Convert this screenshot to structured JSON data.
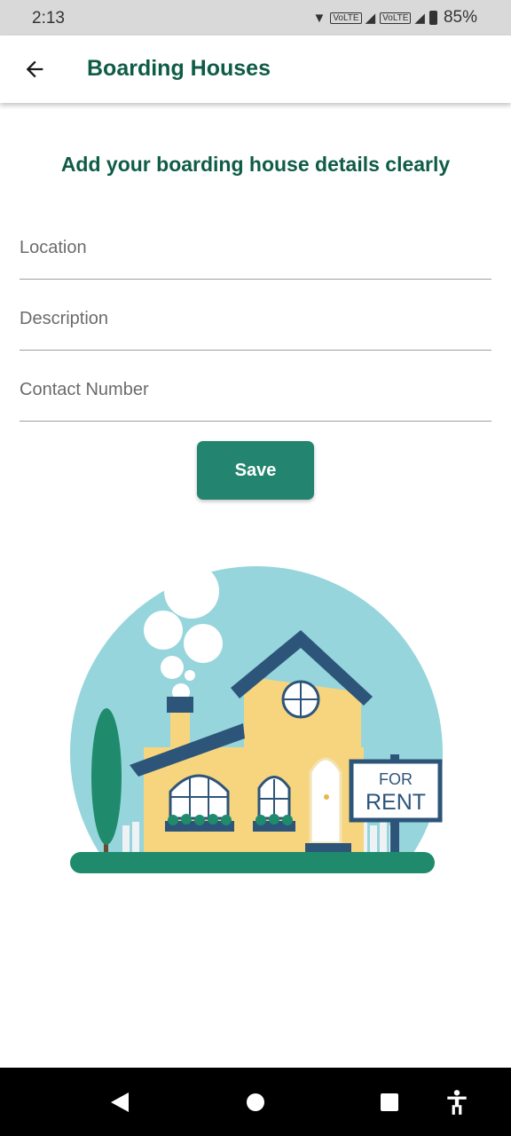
{
  "status_bar": {
    "time": "2:13",
    "network_label": "VoLTE",
    "battery": "85%"
  },
  "app_bar": {
    "title": "Boarding Houses",
    "back_icon": "arrow-left-icon"
  },
  "form": {
    "heading": "Add your boarding house details clearly",
    "location_placeholder": "Location",
    "description_placeholder": "Description",
    "contact_placeholder": "Contact Number",
    "save_label": "Save"
  },
  "illustration": {
    "sign_line1": "FOR",
    "sign_line2": "RENT"
  },
  "colors": {
    "primary": "#0f5c46",
    "button": "#23856f",
    "sky": "#96d5dc",
    "house": "#f7d57e",
    "roof": "#2d5579"
  }
}
